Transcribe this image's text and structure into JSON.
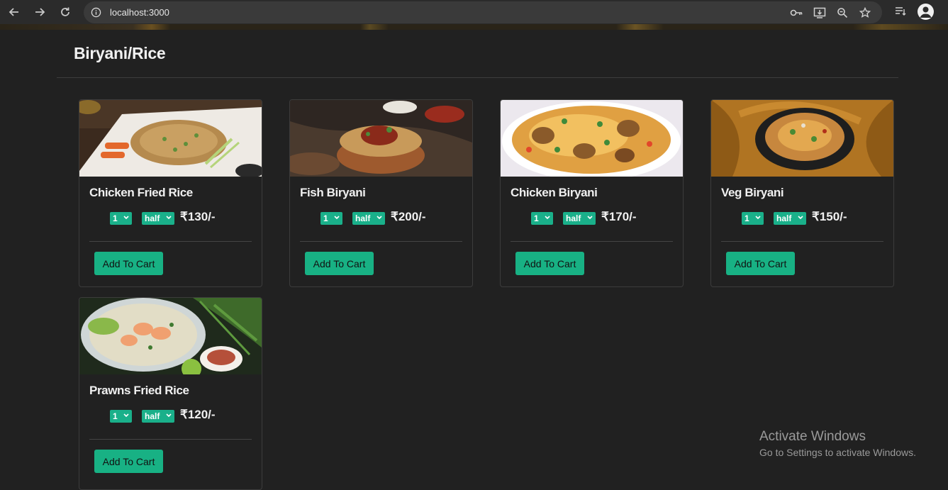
{
  "browser": {
    "url": "localhost:3000"
  },
  "page": {
    "category_title": "Biryani/Rice"
  },
  "items": [
    {
      "name": "Chicken Fried Rice",
      "qty": "1",
      "size": "half",
      "price": "₹130/-",
      "button": "Add To Cart"
    },
    {
      "name": "Fish Biryani",
      "qty": "1",
      "size": "half",
      "price": "₹200/-",
      "button": "Add To Cart"
    },
    {
      "name": "Chicken Biryani",
      "qty": "1",
      "size": "half",
      "price": "₹170/-",
      "button": "Add To Cart"
    },
    {
      "name": "Veg Biryani",
      "qty": "1",
      "size": "half",
      "price": "₹150/-",
      "button": "Add To Cart"
    },
    {
      "name": "Prawns Fried Rice",
      "qty": "1",
      "size": "half",
      "price": "₹120/-",
      "button": "Add To Cart"
    }
  ],
  "watermark": {
    "title": "Activate Windows",
    "subtitle": "Go to Settings to activate Windows."
  },
  "colors": {
    "accent": "#1ab08a",
    "background": "#212121"
  }
}
